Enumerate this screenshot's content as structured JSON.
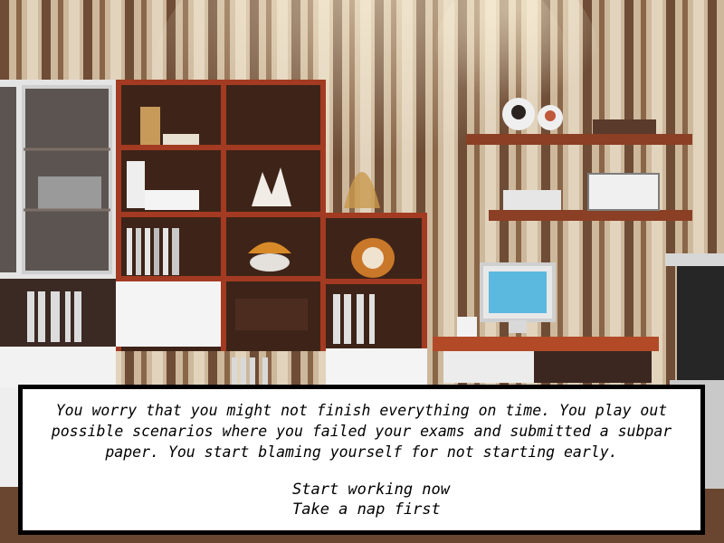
{
  "dialog": {
    "narration": "You worry that you might not finish everything on time. You play out possible scenarios where you failed your exams and submitted a subpar paper. You start blaming yourself for not starting early.",
    "choices": [
      {
        "label": "Start working now"
      },
      {
        "label": "Take a nap first"
      }
    ]
  },
  "colors": {
    "dialog_bg": "#ffffff",
    "dialog_border": "#000000",
    "text": "#000000",
    "wall_stripe_light": "#d6c4ab",
    "wall_stripe_dark": "#6b4a34",
    "shelf_wood": "#5a2e1c",
    "shelf_edge": "#a33a22"
  },
  "icons": [
    "trophy-figurine-icon",
    "photo-frame-icon",
    "monitor-icon",
    "flower-vase-icon"
  ]
}
